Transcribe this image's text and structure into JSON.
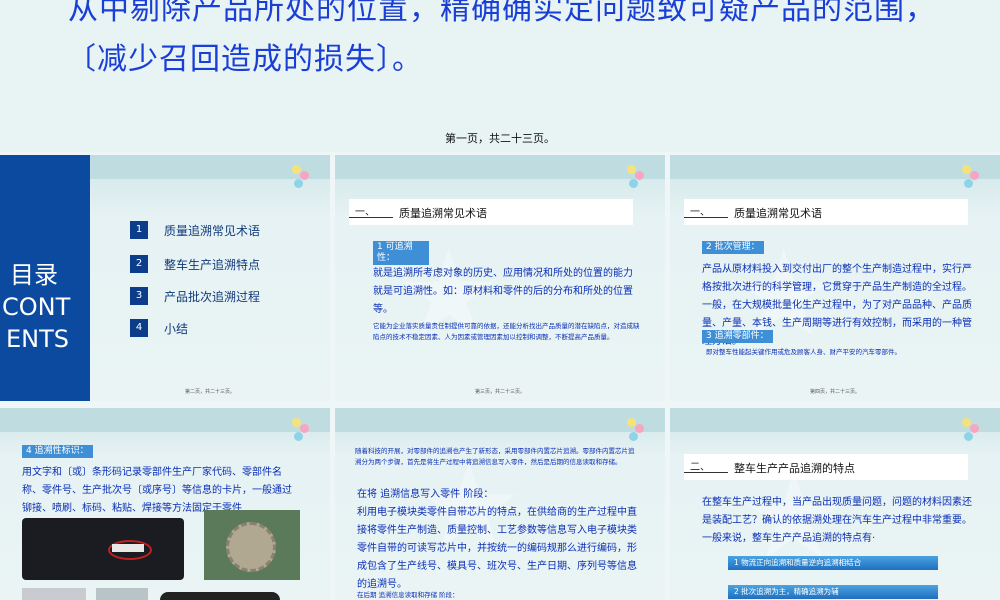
{
  "top": {
    "line1": "从中剔除产品所处的位置，精确确实定问题致可疑产品的范围，",
    "line2": "〔减少召回造成的损失〕。",
    "page": "第一页，共二十三页。"
  },
  "slide1": {
    "toc_title_lines": [
      "目录",
      "CONT",
      "ENTS"
    ],
    "items": [
      {
        "num": "1",
        "label": "质量追溯常见术语"
      },
      {
        "num": "2",
        "label": "整车生产追溯特点"
      },
      {
        "num": "3",
        "label": "产品批次追溯过程"
      },
      {
        "num": "4",
        "label": "小结"
      }
    ],
    "foot": "第二页，共二十三页。"
  },
  "slide2": {
    "hdr_num": "一、",
    "hdr_title": "质量追溯常见术语",
    "tag": "1  可追溯性：",
    "body": "就是追溯所考虑对象的历史、应用情况和所处的位置的能力就是可追溯性。如：原材料和零件的后的分布和所处的位置等。",
    "small": "它能为企业落实质量责任制提供可靠的依据，还能分析找出产品质量的潜在缺陷点，对造成缺陷点的技术不稳定因素、人为因素或管理因素加以控制和调整，不断提高产品质量。",
    "foot": "第三页，共二十三页。"
  },
  "slide3": {
    "hdr_num": "一、",
    "hdr_title": "质量追溯常见术语",
    "tag1": "2  批次管理：",
    "body": "产品从原材料投入到交付出厂的整个生产制造过程中，实行严格按批次进行的科学管理，它贯穿于产品生产制造的全过程。一般，在大规模批量化生产过程中，为了对产品品种、产品质量、产量、本钱、生产周期等进行有效控制，而采用的一种管理方法。",
    "tag2": "3  追溯零部件：",
    "small": "即对整车性能起关键作用或危及顾客人身、财产平安的汽车零部件。",
    "foot": "第四页，共二十三页。"
  },
  "slide4": {
    "tag": "4  追溯性标识：",
    "body": "用文字和〔或〕条形码记录零部件生产厂家代码、零部件名称、零件号、生产批次号〔或序号〕等信息的卡片，一般通过铆接、喷刷、标码、粘贴、焊接等方法固定于零件"
  },
  "slide5": {
    "small_top": "随着科技的开展，对零部件的追溯也产生了新形态，采用零部件内置芯片追溯。零部件内置芯片追溯分为两个步骤，首先是将生产过程中将追溯信息写入零件，然后是后期的信息读取和存储。",
    "subtitle": "在将 追溯信息写入零件 阶段：",
    "body": "利用电子模块类零件自带芯片的特点，在供给商的生产过程中直接将零件生产制造、质量控制、工艺参数等信息写入电子模块类零件自带的可读写芯片中，并按统一的编码规那么进行编码，形成包含了生产线号、模具号、班次号、生产日期、序列号等信息的追溯号。",
    "small_bottom": "在后期 追溯信息读取和存储 阶段："
  },
  "slide6": {
    "hdr_num": "二、",
    "hdr_title": "整车生产产品追溯的特点",
    "body": "在整车生产过程中，当产品出现质量问题，问题的材料因素还是装配工艺？确认的依据溯处理在汽车生产过程中非常重要。一般来说，整车生产产品追溯的特点有·",
    "pill1": "1 物流正向追溯和质量逆向追溯相结合",
    "pill2": "2 批次追溯为主，精确追溯为辅"
  },
  "colors": {
    "accent": "#1a3fd6",
    "navy": "#0c3d8a",
    "body_text": "#0a2fb5"
  }
}
